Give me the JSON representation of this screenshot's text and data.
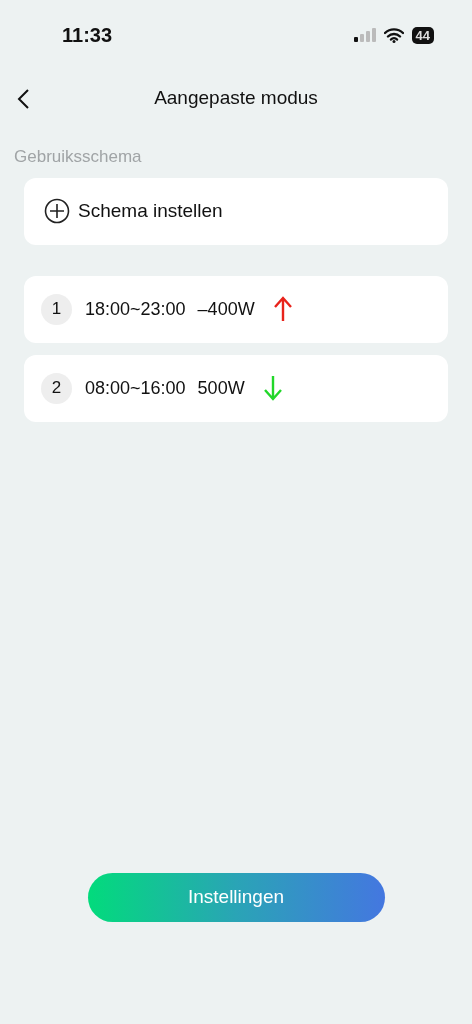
{
  "status_bar": {
    "time": "11:33",
    "battery": "44"
  },
  "header": {
    "title": "Aangepaste modus"
  },
  "section_label": "Gebruiksschema",
  "add_schedule": {
    "label": "Schema instellen"
  },
  "schedules": [
    {
      "index": "1",
      "time": "18:00~23:00",
      "power": "–400W",
      "kind": "up"
    },
    {
      "index": "2",
      "time": "08:00~16:00",
      "power": "500W",
      "kind": "down"
    }
  ],
  "settings_button": "Instellingen"
}
